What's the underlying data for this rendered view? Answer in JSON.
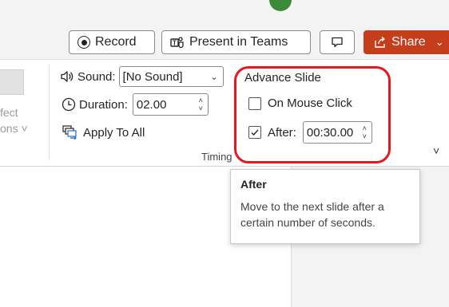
{
  "toolbar": {
    "record_label": "Record",
    "present_label": "Present in Teams",
    "share_label": "Share",
    "share_color": "#c43e1c"
  },
  "effects": {
    "partial_text_1": "fect",
    "partial_text_2": "ons ˅"
  },
  "timing": {
    "sound_label": "Sound:",
    "sound_value": "[No Sound]",
    "duration_label": "Duration:",
    "duration_value": "02.00",
    "apply_all_label": "Apply To All",
    "group_label": "Timing"
  },
  "advance_slide": {
    "title": "Advance Slide",
    "on_mouse_click_label": "On Mouse Click",
    "on_mouse_click_checked": false,
    "after_label": "After:",
    "after_checked": true,
    "after_value": "00:30.00",
    "highlight_color": "#e8161e"
  },
  "tooltip": {
    "title": "After",
    "body": "Move to the next slide after a certain number of seconds."
  },
  "icons": [
    "record-icon",
    "teams-icon",
    "comment-icon",
    "share-icon",
    "chevron-down-icon",
    "speaker-icon",
    "clock-icon",
    "apply-all-icon",
    "checkmark-icon",
    "expand-chevron-icon"
  ]
}
